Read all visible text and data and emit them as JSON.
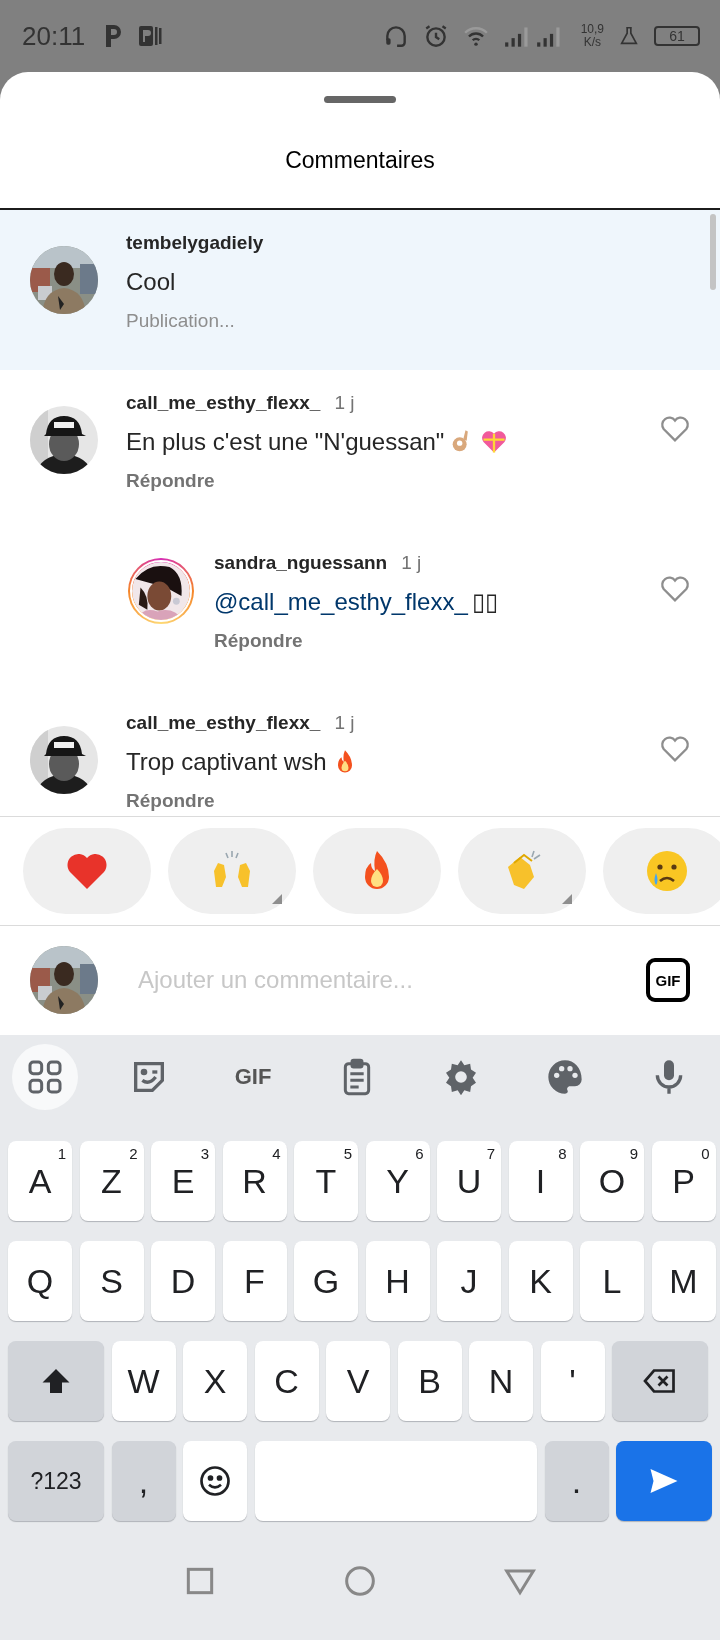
{
  "status_bar": {
    "time": "20:11",
    "speed_value": "10,9",
    "speed_unit": "K/s",
    "battery": "61"
  },
  "sheet": {
    "title": "Commentaires"
  },
  "comments": [
    {
      "kind": "caption",
      "user": "tembelygadiely",
      "text": "Cool",
      "footer": "Publication...",
      "highlighted": true,
      "story_ring": false
    },
    {
      "kind": "comment",
      "user": "call_me_esthy_flexx_",
      "time": "1 j",
      "text": "En plus c'est une \"N'guessan\"",
      "emoji": [
        {
          "kind": "ok_hand"
        },
        {
          "kind": "gift_heart"
        }
      ],
      "footer": "Répondre",
      "liked": false,
      "highlighted": false,
      "story_ring": false,
      "children": [
        {
          "kind": "comment",
          "user": "sandra_nguessann",
          "time": "1 j",
          "mention": "@call_me_esthy_flexx_",
          "text": "▯▯",
          "footer": "Répondre",
          "liked": false,
          "highlighted": false,
          "story_ring": true
        }
      ]
    },
    {
      "kind": "comment",
      "user": "call_me_esthy_flexx_",
      "time": "1 j",
      "text": "Trop captivant wsh",
      "emoji": [
        {
          "kind": "fire"
        }
      ],
      "footer": "Répondre",
      "liked": false,
      "highlighted": false,
      "story_ring": false
    }
  ],
  "reactions": [
    {
      "kind": "heart",
      "more": false
    },
    {
      "kind": "raised_hands",
      "more": true
    },
    {
      "kind": "fire",
      "more": false
    },
    {
      "kind": "clap",
      "more": true
    },
    {
      "kind": "cry",
      "more": false
    }
  ],
  "composer": {
    "placeholder": "Ajouter un commentaire...",
    "gif_label": "GIF"
  },
  "keyboard": {
    "toolbar": [
      {
        "kind": "apps",
        "selected": true
      },
      {
        "kind": "sticker",
        "selected": false
      },
      {
        "kind": "gif",
        "label": "GIF",
        "selected": false
      },
      {
        "kind": "clipboard",
        "selected": false
      },
      {
        "kind": "settings",
        "selected": false
      },
      {
        "kind": "palette",
        "selected": false
      },
      {
        "kind": "mic",
        "selected": false
      }
    ],
    "rows": [
      [
        {
          "kind": "letter",
          "label": "A",
          "hint": "1"
        },
        {
          "kind": "letter",
          "label": "Z",
          "hint": "2"
        },
        {
          "kind": "letter",
          "label": "E",
          "hint": "3"
        },
        {
          "kind": "letter",
          "label": "R",
          "hint": "4"
        },
        {
          "kind": "letter",
          "label": "T",
          "hint": "5"
        },
        {
          "kind": "letter",
          "label": "Y",
          "hint": "6"
        },
        {
          "kind": "letter",
          "label": "U",
          "hint": "7"
        },
        {
          "kind": "letter",
          "label": "I",
          "hint": "8"
        },
        {
          "kind": "letter",
          "label": "O",
          "hint": "9"
        },
        {
          "kind": "letter",
          "label": "P",
          "hint": "0"
        }
      ],
      [
        {
          "kind": "letter",
          "label": "Q"
        },
        {
          "kind": "letter",
          "label": "S"
        },
        {
          "kind": "letter",
          "label": "D"
        },
        {
          "kind": "letter",
          "label": "F"
        },
        {
          "kind": "letter",
          "label": "G"
        },
        {
          "kind": "letter",
          "label": "H"
        },
        {
          "kind": "letter",
          "label": "J"
        },
        {
          "kind": "letter",
          "label": "K"
        },
        {
          "kind": "letter",
          "label": "L"
        },
        {
          "kind": "letter",
          "label": "M"
        }
      ],
      [
        {
          "kind": "shift"
        },
        {
          "kind": "letter",
          "label": "W"
        },
        {
          "kind": "letter",
          "label": "X"
        },
        {
          "kind": "letter",
          "label": "C"
        },
        {
          "kind": "letter",
          "label": "V"
        },
        {
          "kind": "letter",
          "label": "B"
        },
        {
          "kind": "letter",
          "label": "N"
        },
        {
          "kind": "letter",
          "label": "'"
        },
        {
          "kind": "backspace"
        }
      ],
      [
        {
          "kind": "mode",
          "label": "?123"
        },
        {
          "kind": "punct",
          "label": ","
        },
        {
          "kind": "emoji"
        },
        {
          "kind": "space"
        },
        {
          "kind": "punct",
          "label": "."
        },
        {
          "kind": "send"
        }
      ]
    ]
  }
}
